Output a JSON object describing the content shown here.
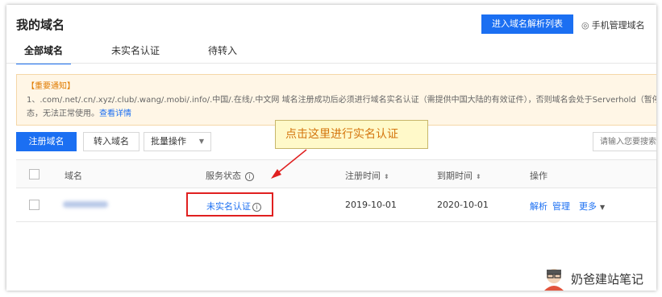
{
  "page": {
    "title": "我的域名"
  },
  "header": {
    "primary_button": "进入域名解析列表",
    "mobile_link": "手机管理域名"
  },
  "tabs": [
    {
      "label": "全部域名",
      "active": true
    },
    {
      "label": "未实名认证",
      "active": false
    },
    {
      "label": "待转入",
      "active": false
    }
  ],
  "notice": {
    "title": "【重要通知】",
    "line1": "1、.com/.net/.cn/.xyz/.club/.wang/.mobi/.info/.中国/.在线/.中文网 域名注册成功后必须进行域名实名认证（需提供中国大陆的有效证件），否则域名会处于Serverhold（暂停解",
    "line2_prefix": "态，无法正常使用。",
    "line2_link": "查看详情"
  },
  "toolbar": {
    "register": "注册域名",
    "transfer": "转入域名",
    "batch": "批量操作",
    "search_placeholder": "请输入您要搜索"
  },
  "table": {
    "headers": {
      "domain": "域名",
      "status": "服务状态",
      "reg_time": "注册时间",
      "exp_time": "到期时间",
      "action": "操作"
    },
    "rows": [
      {
        "status": "未实名认证",
        "reg_time": "2019-10-01",
        "exp_time": "2020-10-01",
        "op_resolve": "解析",
        "op_manage": "管理",
        "op_more": "更多"
      }
    ]
  },
  "annotation": {
    "callout": "点击这里进行实名认证"
  },
  "watermark": {
    "text": "奶爸建站笔记"
  },
  "colors": {
    "accent": "#1b6ff2",
    "highlight": "#e02020",
    "notice_title": "#e07b00"
  }
}
